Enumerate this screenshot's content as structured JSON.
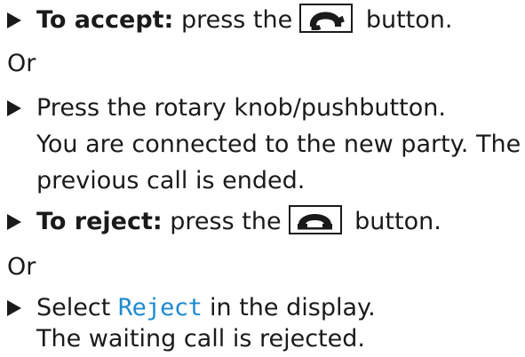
{
  "step_accept": {
    "lead": "To accept:",
    "text_before": " press the",
    "icon": "phone-accept-icon",
    "text_after": " button."
  },
  "or_1": "Or",
  "step_knob": {
    "text": "Press the rotary knob/pushbutton.",
    "result_line_1": "You are connected to the new party. The",
    "result_line_2": "previous call is ended."
  },
  "step_reject": {
    "lead": "To reject:",
    "text_before": " press the",
    "icon": "phone-hangup-icon",
    "text_after": " button."
  },
  "or_2": "Or",
  "step_select": {
    "text_before": "Select ",
    "display_item": "Reject",
    "text_after": " in the display.",
    "result": "The waiting call is rejected."
  },
  "colors": {
    "display_text": "#1c8ad0",
    "text": "#1a1a1a"
  }
}
